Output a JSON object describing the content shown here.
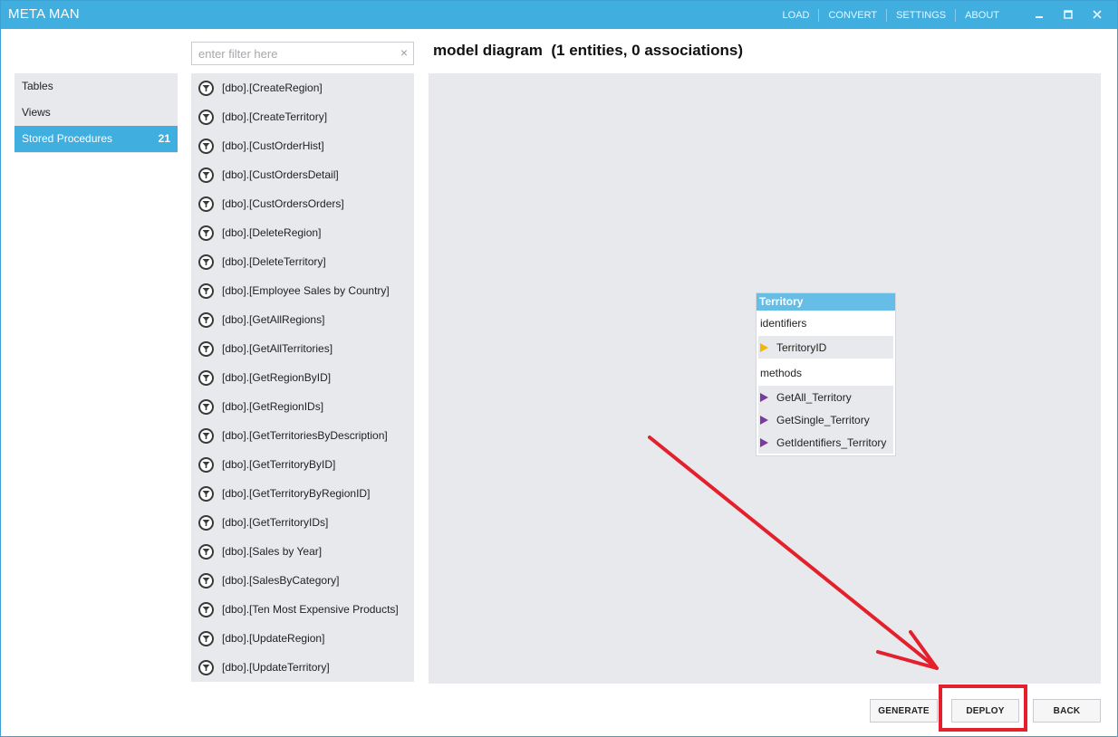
{
  "app": {
    "title": "META MAN"
  },
  "topnav": {
    "items": [
      {
        "label": "LOAD"
      },
      {
        "label": "CONVERT"
      },
      {
        "label": "SETTINGS"
      },
      {
        "label": "ABOUT"
      }
    ]
  },
  "window_controls": [
    "minimize-icon",
    "maximize-icon",
    "close-icon"
  ],
  "sidebar": {
    "items": [
      {
        "label": "Tables",
        "count": "",
        "active": false
      },
      {
        "label": "Views",
        "count": "",
        "active": false
      },
      {
        "label": "Stored Procedures",
        "count": "21",
        "active": true
      }
    ]
  },
  "filter": {
    "placeholder": "enter filter here",
    "value": "",
    "clear_glyph": "×"
  },
  "procedures": [
    "[dbo].[CreateRegion]",
    "[dbo].[CreateTerritory]",
    "[dbo].[CustOrderHist]",
    "[dbo].[CustOrdersDetail]",
    "[dbo].[CustOrdersOrders]",
    "[dbo].[DeleteRegion]",
    "[dbo].[DeleteTerritory]",
    "[dbo].[Employee Sales by Country]",
    "[dbo].[GetAllRegions]",
    "[dbo].[GetAllTerritories]",
    "[dbo].[GetRegionByID]",
    "[dbo].[GetRegionIDs]",
    "[dbo].[GetTerritoriesByDescription]",
    "[dbo].[GetTerritoryByID]",
    "[dbo].[GetTerritoryByRegionID]",
    "[dbo].[GetTerritoryIDs]",
    "[dbo].[Sales by Year]",
    "[dbo].[SalesByCategory]",
    "[dbo].[Ten Most Expensive Products]",
    "[dbo].[UpdateRegion]",
    "[dbo].[UpdateTerritory]"
  ],
  "diagram": {
    "title": "model diagram  (1 entities, 0 associations)",
    "entity": {
      "name": "Territory",
      "identifiers_label": "identifiers",
      "identifiers": [
        "TerritoryID"
      ],
      "methods_label": "methods",
      "methods": [
        "GetAll_Territory",
        "GetSingle_Territory",
        "GetIdentifiers_Territory"
      ]
    }
  },
  "actions": {
    "generate": "GENERATE",
    "deploy": "DEPLOY",
    "back": "BACK"
  },
  "colors": {
    "titlebar": "#41aee0",
    "active_nav": "#41aee0",
    "panel": "#e8e9ed",
    "entity_header": "#66bde6",
    "identifier_marker": "#f2b705",
    "method_marker": "#7a3aa0",
    "annotation": "#e3202c"
  }
}
